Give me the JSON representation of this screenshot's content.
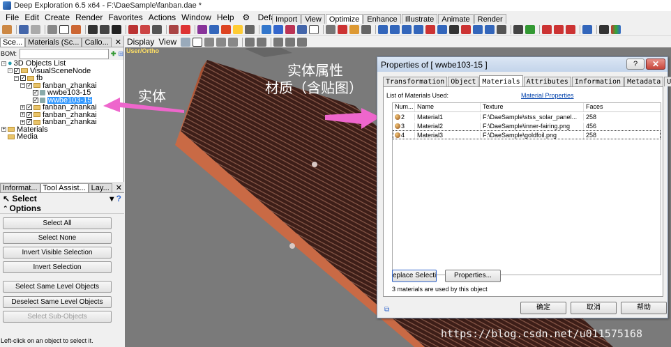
{
  "window": {
    "title": "Deep Exploration 6.5 x64 - F:\\DaeSample\\fanban.dae *"
  },
  "menu": [
    "File",
    "Edit",
    "Create",
    "Render",
    "Favorites",
    "Actions",
    "Window",
    "Help",
    "Default"
  ],
  "ribbon_tabs": [
    "Import",
    "View",
    "Optimize",
    "Enhance",
    "Illustrate",
    "Animate",
    "Render"
  ],
  "viewport_toolbar": {
    "display": "Display",
    "view": "View"
  },
  "left_panel": {
    "tabs": [
      "Sce...",
      "Materials (Sc...",
      "Callo..."
    ],
    "bom_label": "BOM:",
    "tree": [
      {
        "label": "3D Objects List",
        "level": 0
      },
      {
        "label": "VisualSceneNode",
        "level": 1
      },
      {
        "label": "fb",
        "level": 2
      },
      {
        "label": "fanban_zhankai",
        "level": 3
      },
      {
        "label": "wwbe103-15",
        "level": 4
      },
      {
        "label": "wwbe103-15",
        "level": 4,
        "selected": true
      },
      {
        "label": "fanban_zhankai",
        "level": 3
      },
      {
        "label": "fanban_zhankai",
        "level": 3
      },
      {
        "label": "fanban_zhankai",
        "level": 3
      },
      {
        "label": "Materials",
        "level": 0
      },
      {
        "label": "Media",
        "level": 0
      }
    ]
  },
  "tool_panel": {
    "tabs": [
      "Informat...",
      "Tool Assist...",
      "Lay..."
    ],
    "select_label": "Select",
    "options_label": "Options",
    "buttons": [
      "Select All",
      "Select None",
      "Invert Visible Selection",
      "Invert Selection",
      "Select Same Level Objects",
      "Deselect Same Level Objects",
      "Select Sub-Objects"
    ]
  },
  "status_bar": "Left-click on an object to select it.",
  "viewport": {
    "label": "User/Ortho"
  },
  "annotations": {
    "entity": "实体",
    "entity_attr": "实体属性",
    "material": "材质（含贴图）"
  },
  "dialog": {
    "title": "Properties of  [ wwbe103-15 ]",
    "tabs": [
      "Transformation",
      "Object",
      "Materials",
      "Attributes",
      "Information",
      "Metadata",
      "UV"
    ],
    "list_label": "List of Materials Used:",
    "material_properties_link": "Material Properties",
    "columns": [
      "Num...",
      "Name",
      "Texture",
      "Faces"
    ],
    "rows": [
      {
        "num": "2",
        "name": "Material1",
        "texture": "F:\\DaeSample\\stss_solar_panel...",
        "faces": "258"
      },
      {
        "num": "3",
        "name": "Material2",
        "texture": "F:\\DaeSample\\inner-fairing.png",
        "faces": "456"
      },
      {
        "num": "4",
        "name": "Material3",
        "texture": "F:\\DaeSample\\goldfoil.png",
        "faces": "258"
      }
    ],
    "replace_button": "eplace Selectio",
    "properties_button": "Properties...",
    "count_text": "3 materials are used by this object",
    "ok_button": "确定",
    "cancel_button": "取消",
    "help_button": "帮助"
  },
  "watermark": "https://blog.csdn.net/u011575168",
  "colors": {
    "annotation_arrow": "#ee66cc",
    "selection": "#3399ff",
    "panel_texture": "#5a2a22"
  }
}
